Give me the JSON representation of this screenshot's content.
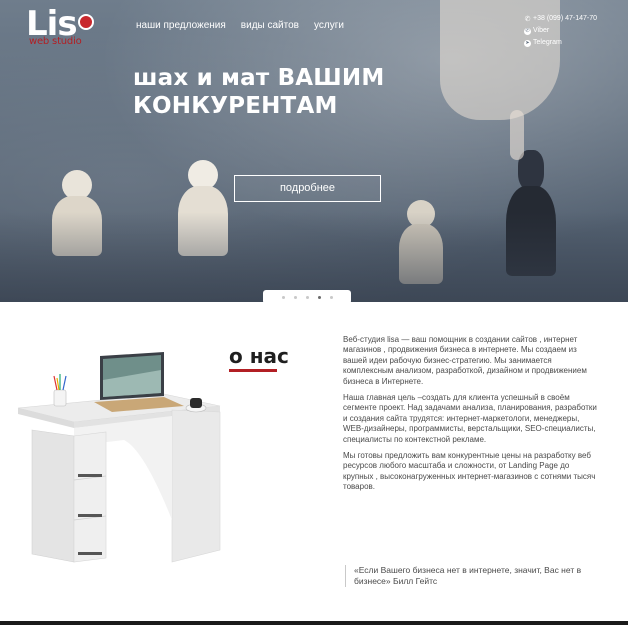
{
  "logo": {
    "text": "Lis",
    "subtitle": "web studio",
    "accent_color": "#b21f24"
  },
  "nav": {
    "items": [
      {
        "label": "наши предложения"
      },
      {
        "label": "виды сайтов"
      },
      {
        "label": "услуги"
      }
    ]
  },
  "contacts": {
    "phone": "+38 (099) 47-147-70",
    "viber": "Viber",
    "telegram": "Telegram"
  },
  "hero": {
    "title_line1": "шах и мат ВАШИМ",
    "title_line2": "КОНКУРЕНТАМ",
    "button_label": "подробнее",
    "slides_total": 5,
    "active_slide": 4
  },
  "about": {
    "title": "о нас",
    "paragraphs": [
      "Веб-студия lisa — ваш помощник в создании сайтов , интернет магазинов , продвижения бизнеса в интернете. Мы создаем из вашей идеи рабочую бизнес-стратегию. Мы занимается комплексным анализом, разработкой, дизайном и продвижением бизнеса в Интернете.",
      "Наша главная цель –создать для клиента успешный в своём сегменте проект. Над задачами анализа, планирования, разработки и создания сайта трудятся: интернет-маркетологи, менеджеры, WEB-дизайнеры, программисты, верстальщики, SEO-специалисты, специалисты по контекстной рекламе.",
      "Мы готовы предложить вам конкурентные цены на разработку веб ресурсов любого масштаба и сложности, от Landing Page до крупных , высоконагруженных интернет-магазинов с сотнями тысяч товаров."
    ],
    "quote": "«Если Вашего бизнеса нет в интернете, значит, Вас нет в бизнесе» Билл Гейтс"
  }
}
